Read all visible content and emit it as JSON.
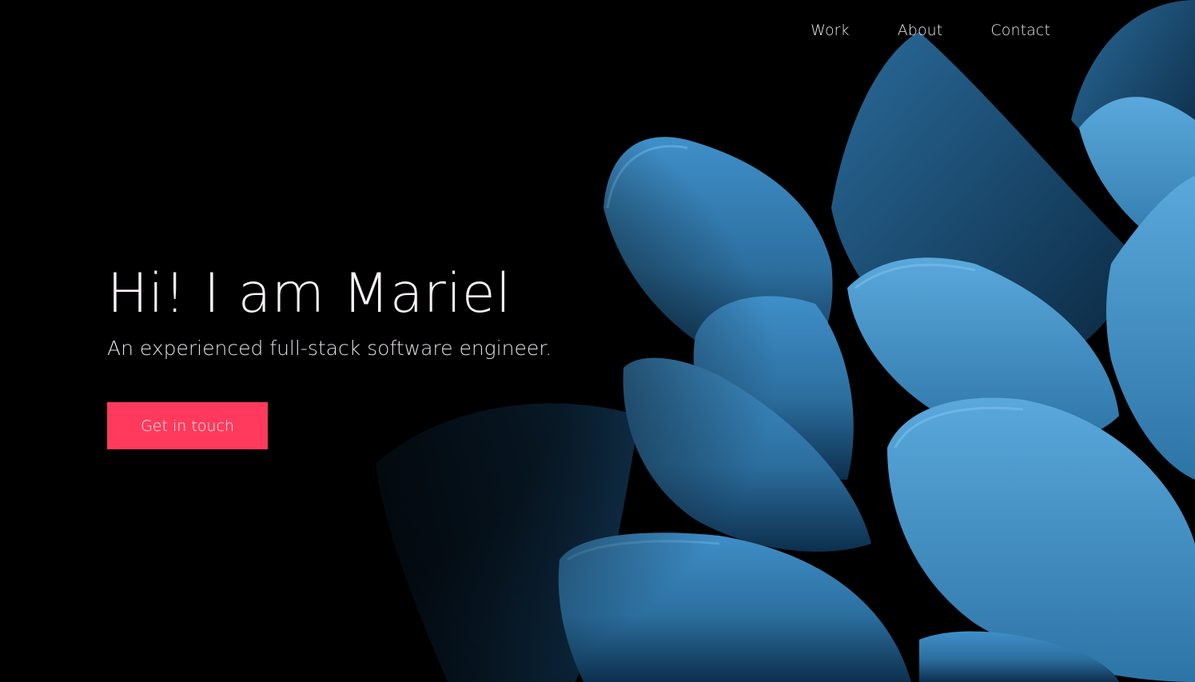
{
  "nav": {
    "items": [
      {
        "label": "Work"
      },
      {
        "label": "About"
      },
      {
        "label": "Contact"
      }
    ]
  },
  "hero": {
    "title": "Hi! I am Mariel",
    "subtitle": "An experienced full-stack software engineer.",
    "cta_label": "Get in touch"
  },
  "colors": {
    "background": "#000000",
    "accent": "#ff3a5c",
    "petal_light": "#3a8dc6",
    "petal_dark": "#0f3a5e"
  }
}
